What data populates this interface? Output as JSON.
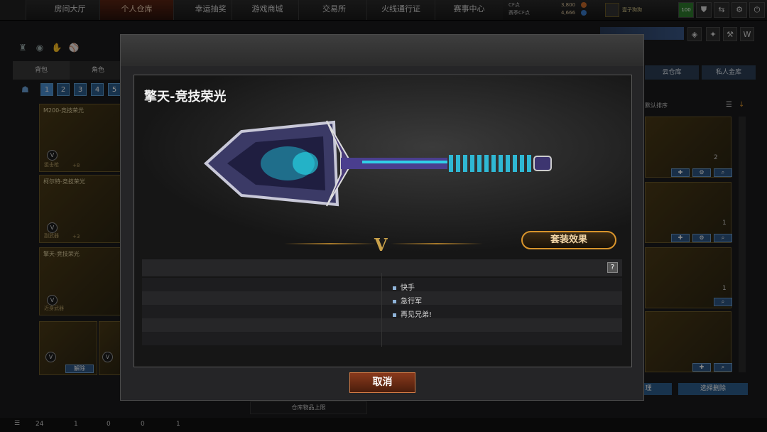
{
  "top_nav": {
    "tabs": [
      {
        "label": "房间大厅"
      },
      {
        "label": "个人仓库"
      },
      {
        "label": "幸运抽奖"
      },
      {
        "label": "游戏商城"
      },
      {
        "label": "交易所"
      },
      {
        "label": "火线通行证"
      },
      {
        "label": "赛事中心"
      }
    ],
    "active_tab": "个人仓库",
    "currency": {
      "cf_label": "CF点",
      "cf_value": "3,800",
      "season_label": "赛季CF点",
      "season_value": "4,666"
    },
    "username": "壹子狗狗",
    "level_badge": "100"
  },
  "left_panel": {
    "tabs": [
      {
        "label": "背包"
      },
      {
        "label": "角色"
      }
    ],
    "pages": [
      "1",
      "2",
      "3",
      "4",
      "5"
    ],
    "items": [
      {
        "name": "M200-竞技荣光",
        "type": "狙击枪",
        "extra": "+8"
      },
      {
        "name": "柯尔特-竞技荣光",
        "type": "副武器",
        "extra": "+3"
      },
      {
        "name": "擎天-竞技荣光",
        "type": "近身武器",
        "extra": ""
      }
    ],
    "unequip_label": "解除"
  },
  "right_panel": {
    "tabs": [
      {
        "label": "云仓库"
      },
      {
        "label": "私人金库"
      }
    ],
    "sort_label": "默认排序",
    "item_counts": [
      "2",
      "1",
      "1"
    ],
    "buttons": [
      {
        "label": "理"
      },
      {
        "label": "选择删除"
      }
    ]
  },
  "bottom_bar": {
    "stock_label": "仓库物品上限",
    "stats": [
      "24",
      "1",
      "0",
      "0",
      "1"
    ]
  },
  "modal": {
    "title": "擎天-竞技荣光",
    "emblem": "V",
    "suit_button": "套装效果",
    "help_label": "?",
    "perks": [
      "快手",
      "急行军",
      "再见兄弟!"
    ],
    "cancel_label": "取消"
  },
  "colors": {
    "accent_gold": "#d8942c",
    "accent_blue": "#2d5d8c",
    "cancel_red": "#8a3a1c"
  }
}
